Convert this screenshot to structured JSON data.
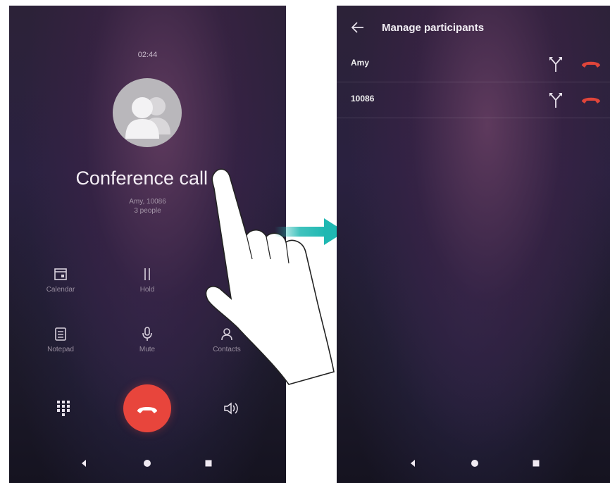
{
  "left_screen": {
    "call_timer": "02:44",
    "title": "Conference call",
    "title_chevron": "›",
    "participants_line": "Amy, 10086",
    "people_count_line": "3 people",
    "controls": [
      {
        "label": "Calendar",
        "icon": "calendar-icon"
      },
      {
        "label": "Hold",
        "icon": "hold-icon"
      },
      {
        "label": "Notepad",
        "icon": "notepad-icon"
      },
      {
        "label": "Mute",
        "icon": "mic-icon"
      },
      {
        "label": "Contacts",
        "icon": "contacts-icon"
      }
    ],
    "bottom": {
      "dialpad_icon": "dialpad-icon",
      "end_icon": "phone-hangup-icon",
      "speaker_icon": "speaker-icon"
    }
  },
  "right_screen": {
    "title": "Manage participants",
    "participants": [
      {
        "name": "Amy"
      },
      {
        "name": "10086"
      }
    ]
  },
  "colors": {
    "end_call": "#e8453c",
    "arrow": "#1fb8b2",
    "hangup_small": "#e0453a"
  }
}
